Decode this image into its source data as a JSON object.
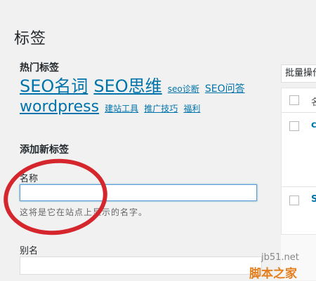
{
  "page": {
    "title": "标签"
  },
  "popular": {
    "heading": "热门标签",
    "tags": [
      "SEO名词",
      "SEO思维",
      "seo诊断",
      "SEO问答",
      "wordpress",
      "建站工具",
      "推广技巧",
      "福利"
    ]
  },
  "add_form": {
    "heading": "添加新标签",
    "name_label": "名称",
    "name_value": "",
    "name_hint": "这将是它在站点上显示的名字。",
    "slug_label": "别名",
    "slug_value": ""
  },
  "list": {
    "bulk_label": "批量操作",
    "header_col": "名",
    "rows": [
      "c",
      "S"
    ]
  },
  "watermark": {
    "domain": "jb51.net",
    "brand": "脚本之家"
  },
  "colors": {
    "link": "#0073aa",
    "highlight": "#d4262c",
    "watermark": "#e57e1d"
  }
}
